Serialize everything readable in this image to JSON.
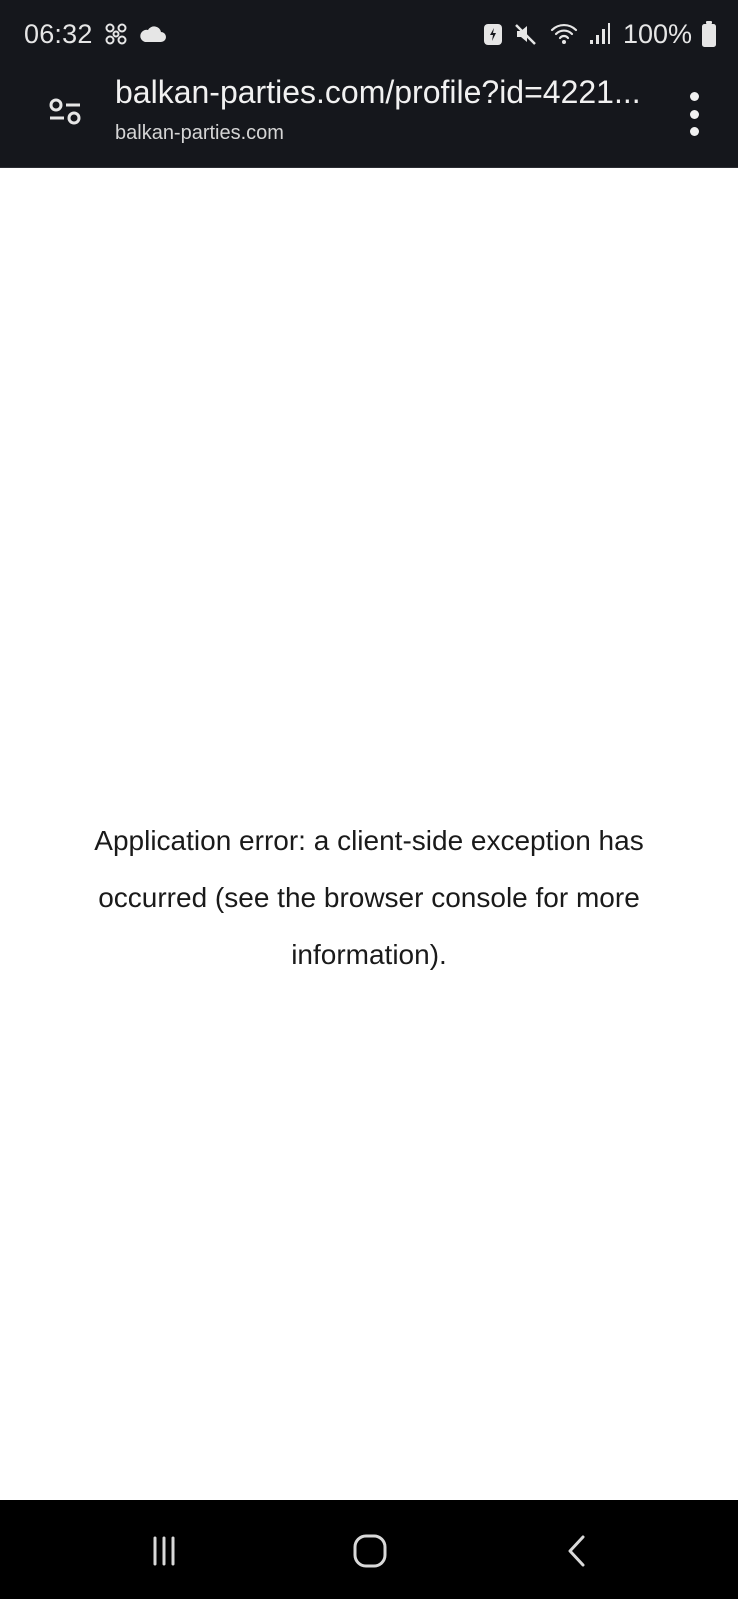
{
  "status_bar": {
    "time": "06:32",
    "battery": "100%",
    "icons": [
      "fan-icon",
      "cloud-icon",
      "battery-saver-icon",
      "mute-icon",
      "wifi-icon",
      "signal-icon",
      "battery-icon"
    ]
  },
  "browser": {
    "url": "balkan-parties.com/profile?id=4221...",
    "domain": "balkan-parties.com"
  },
  "page": {
    "error_message": "Application error: a client-side exception has occurred (see the browser console for more information)."
  },
  "navigation": {
    "buttons": [
      "recents-button",
      "home-button",
      "back-button"
    ]
  }
}
